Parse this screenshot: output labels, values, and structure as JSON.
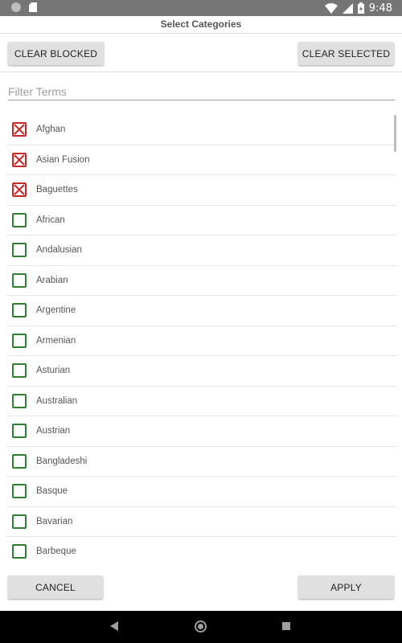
{
  "status_bar": {
    "time": "9:48",
    "icons": [
      "circle-notification-icon",
      "sd-card-icon",
      "wifi-icon",
      "signal-icon",
      "battery-charging-icon"
    ],
    "background": "#757575"
  },
  "dialog": {
    "title": "Select Categories",
    "clear_blocked_label": "CLEAR BLOCKED",
    "clear_selected_label": "CLEAR SELECTED",
    "filter_placeholder": "Filter Terms",
    "filter_value": "",
    "cancel_label": "CANCEL",
    "apply_label": "APPLY"
  },
  "categories": [
    {
      "label": "Afghan",
      "state": "blocked"
    },
    {
      "label": "Asian Fusion",
      "state": "blocked"
    },
    {
      "label": "Baguettes",
      "state": "blocked"
    },
    {
      "label": "African",
      "state": "unselected"
    },
    {
      "label": "Andalusian",
      "state": "unselected"
    },
    {
      "label": "Arabian",
      "state": "unselected"
    },
    {
      "label": "Argentine",
      "state": "unselected"
    },
    {
      "label": "Armenian",
      "state": "unselected"
    },
    {
      "label": "Asturian",
      "state": "unselected"
    },
    {
      "label": "Australian",
      "state": "unselected"
    },
    {
      "label": "Austrian",
      "state": "unselected"
    },
    {
      "label": "Bangladeshi",
      "state": "unselected"
    },
    {
      "label": "Basque",
      "state": "unselected"
    },
    {
      "label": "Bavarian",
      "state": "unselected"
    },
    {
      "label": "Barbeque",
      "state": "unselected"
    }
  ],
  "colors": {
    "blocked": "#c62828",
    "unselected": "#2e7d32",
    "button_bg": "#e0e0e0"
  },
  "nav_bar": {
    "icons": [
      "back-icon",
      "home-icon",
      "recents-icon"
    ]
  }
}
